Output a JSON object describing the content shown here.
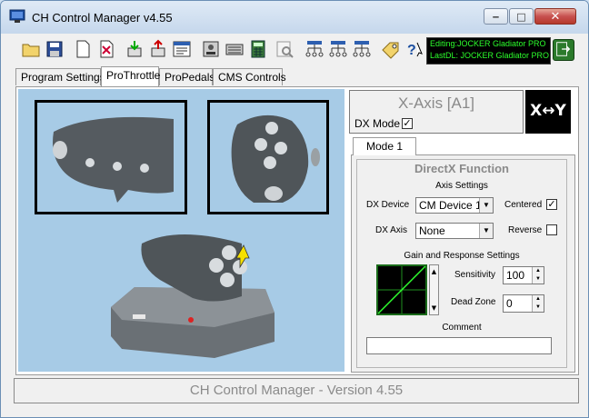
{
  "window": {
    "title": "CH Control Manager v4.55",
    "minimize_glyph": "‒",
    "maximize_glyph": "□",
    "close_glyph": "✕"
  },
  "toolbar": {
    "icons": [
      "open-folder-icon",
      "save-icon",
      "new-file-icon",
      "map-icon",
      "download-icon",
      "upload-icon",
      "list-window-icon",
      "device-properties-icon",
      "keyboard-icon",
      "calculator-icon",
      "search-icon",
      "tree-icon",
      "tree-2-icon",
      "tree-3-icon",
      "tag-icon",
      "help-icon"
    ],
    "status_editing": "Editing:JOCKER Gladiator PRO",
    "status_lastdl": "LastDL: JOCKER Gladiator PRO",
    "exit_icon": "exit-icon"
  },
  "tabs": [
    {
      "label": "Program Settings",
      "active": false
    },
    {
      "label": "ProThrottle",
      "active": true
    },
    {
      "label": "ProPedals",
      "active": false
    },
    {
      "label": "CMS Controls",
      "active": false
    }
  ],
  "axis_panel": {
    "title": "X-Axis [A1]",
    "dx_mode_label": "DX Mode",
    "dx_mode_checked": true,
    "logo_text": "X↔Y"
  },
  "mode": {
    "tab_label": "Mode 1",
    "section_title": "DirectX Function",
    "axis_settings_label": "Axis Settings",
    "dx_device_label": "DX Device",
    "dx_device_value": "CM Device 1",
    "centered_label": "Centered",
    "centered_checked": true,
    "dx_axis_label": "DX Axis",
    "dx_axis_value": "None",
    "reverse_label": "Reverse",
    "reverse_checked": false,
    "gain_label": "Gain and Response Settings",
    "sensitivity_label": "Sensitivity",
    "sensitivity_value": "100",
    "dead_zone_label": "Dead Zone",
    "dead_zone_value": "0",
    "comment_label": "Comment",
    "comment_value": ""
  },
  "statusbar": {
    "text": "CH Control Manager - Version 4.55"
  }
}
